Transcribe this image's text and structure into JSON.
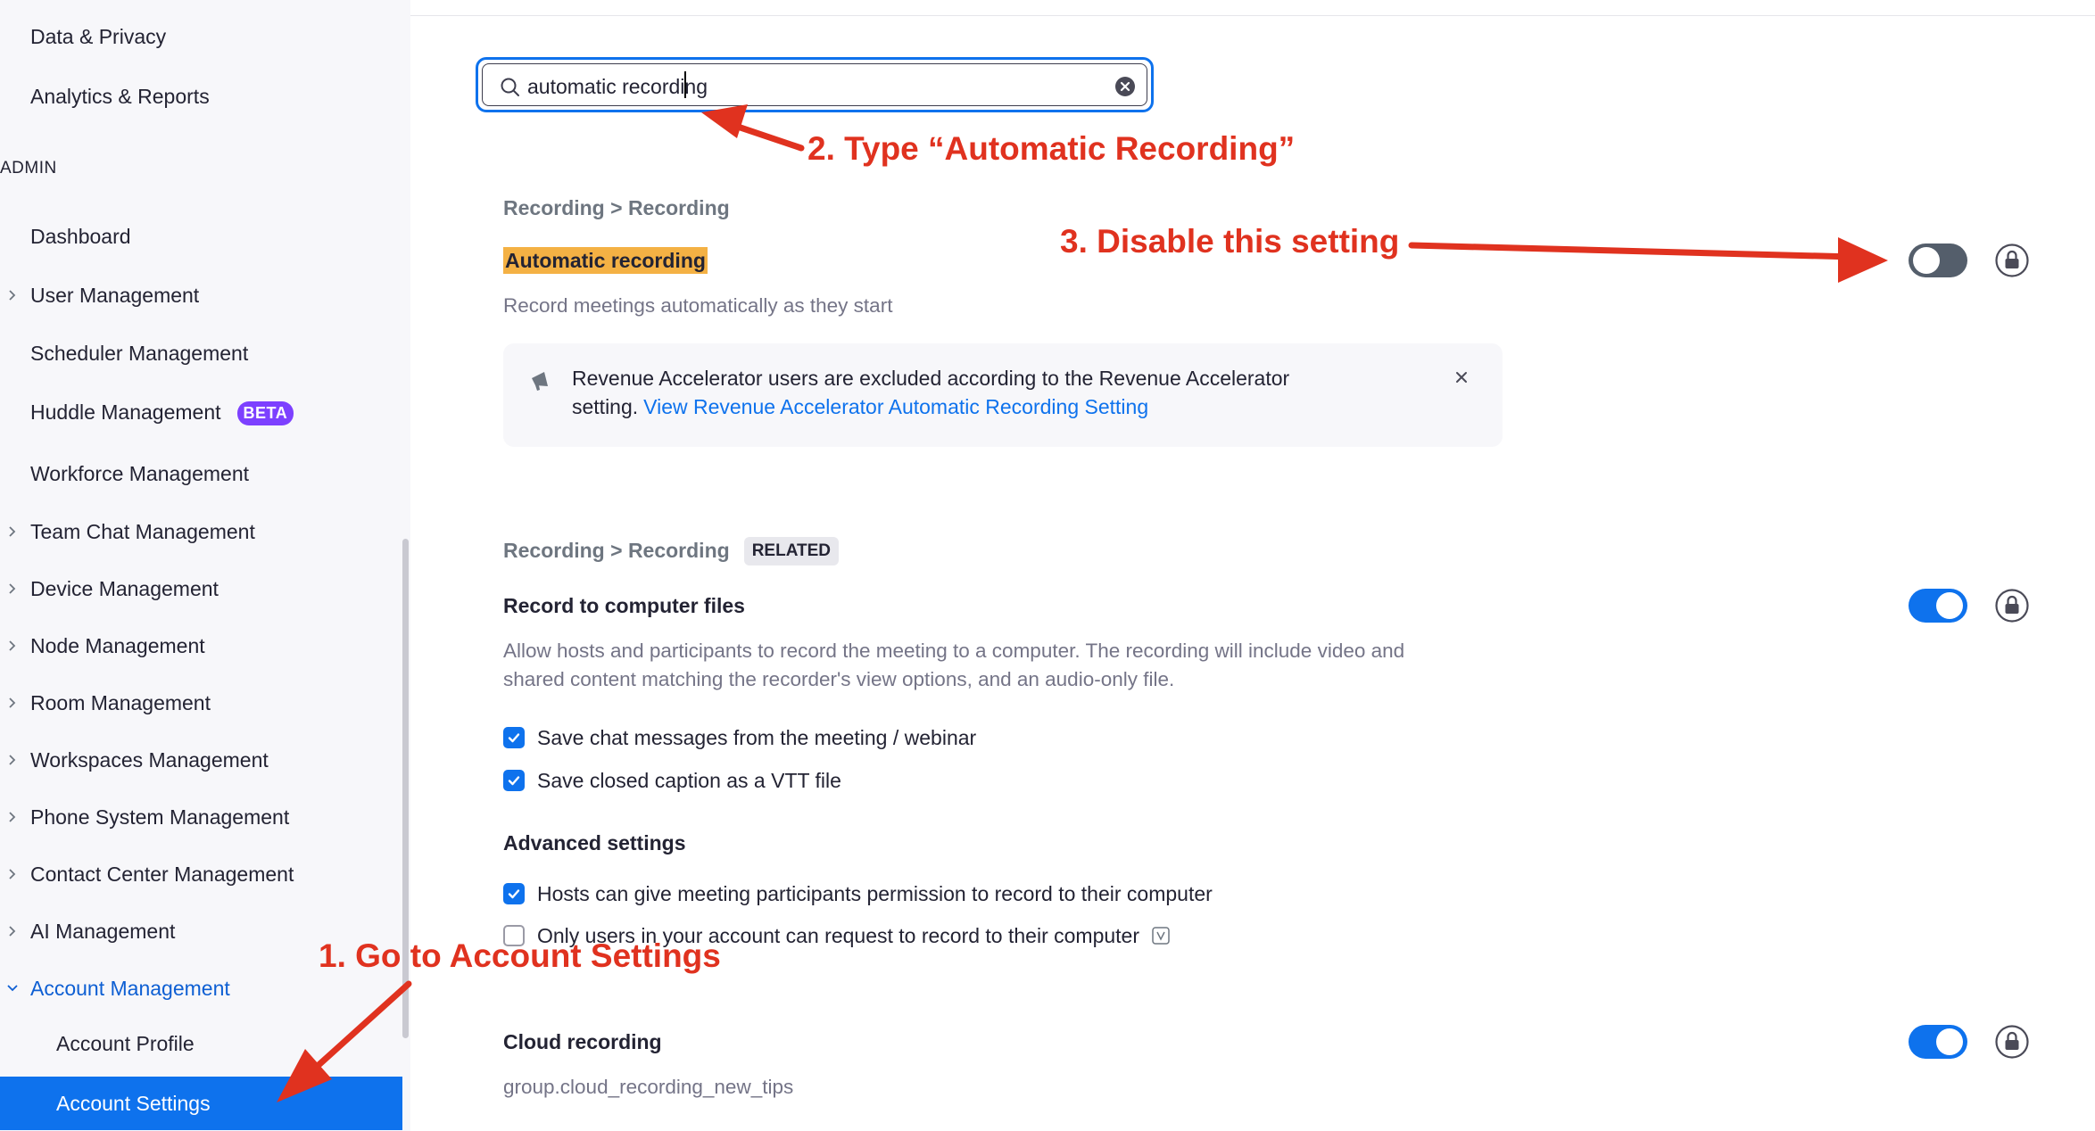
{
  "sidebar": {
    "items": [
      {
        "label": "Data & Privacy"
      },
      {
        "label": "Analytics & Reports"
      },
      {
        "label": "Dashboard"
      },
      {
        "label": "User Management"
      },
      {
        "label": "Scheduler Management"
      },
      {
        "label": "Huddle Management",
        "badge": "BETA"
      },
      {
        "label": "Workforce Management"
      },
      {
        "label": "Team Chat Management"
      },
      {
        "label": "Device Management"
      },
      {
        "label": "Node Management"
      },
      {
        "label": "Room Management"
      },
      {
        "label": "Workspaces Management"
      },
      {
        "label": "Phone System Management"
      },
      {
        "label": "Contact Center Management"
      },
      {
        "label": "AI Management"
      },
      {
        "label": "Account Management"
      },
      {
        "label": "Account Profile"
      },
      {
        "label": "Account Settings"
      }
    ],
    "section_label": "ADMIN"
  },
  "search": {
    "value": "automatic recording"
  },
  "settings": [
    {
      "breadcrumb": "Recording > Recording",
      "title": "Automatic recording",
      "description": "Record meetings automatically as they start",
      "enabled": false,
      "notice": {
        "text": "Revenue Accelerator users are excluded according to the Revenue Accelerator",
        "text2": "setting.",
        "link": "View Revenue Accelerator Automatic Recording Setting"
      }
    },
    {
      "breadcrumb": "Recording > Recording",
      "tag": "RELATED",
      "title": "Record to computer files",
      "description_line1": "Allow hosts and participants to record the meeting to a computer. The recording will include video and",
      "description_line2": "shared content matching the recorder's view options, and an audio-only file.",
      "enabled": true,
      "options": [
        {
          "label": "Save chat messages from the meeting / webinar",
          "checked": true
        },
        {
          "label": "Save closed caption as a VTT file",
          "checked": true
        }
      ],
      "advanced_title": "Advanced settings",
      "advanced_options": [
        {
          "label": "Hosts can give meeting participants permission to record to their computer",
          "checked": true
        },
        {
          "label": "Only users in your account can request to record to their computer",
          "checked": false
        }
      ]
    },
    {
      "title": "Cloud recording",
      "description": "group.cloud_recording_new_tips",
      "enabled": true
    }
  ],
  "annotations": {
    "step1": "1. Go to Account Settings",
    "step2": "2. Type “Automatic Recording”",
    "step3": "3. Disable this setting"
  },
  "colors": {
    "accent": "#0e72ed",
    "annotation": "#e0321f",
    "highlight": "#f4b144",
    "badge": "#7d40ff"
  },
  "icons": [
    "chevron-right-icon",
    "chevron-down-icon",
    "search-icon",
    "clear-icon",
    "megaphone-icon",
    "close-icon",
    "lock-icon",
    "info-icon",
    "checkmark-icon"
  ]
}
